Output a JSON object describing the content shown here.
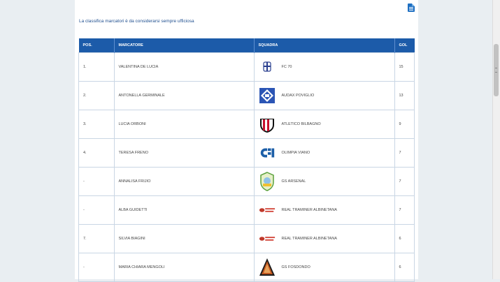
{
  "notice": "La classifica marcatori è da considerarsi sempre ufficiosa",
  "table": {
    "headers": {
      "pos": "POS.",
      "scorer": "MARCATORE",
      "team": "SQUADRA",
      "goals": "GOL"
    },
    "rows": [
      {
        "pos": "1.",
        "scorer": "VALENTINA DE LUCIA",
        "team": "FC 70",
        "goals": "15",
        "logo": "fc70-crest-icon"
      },
      {
        "pos": "2.",
        "scorer": "ANTONELLA GERMINALE",
        "team": "AUDAX POVIGLIO",
        "goals": "13",
        "logo": "audax-poviglio-crest-icon"
      },
      {
        "pos": "3.",
        "scorer": "LUCIA ORBONI",
        "team": "ATLETICO BILBAGNO",
        "goals": "9",
        "logo": "atletico-bilbagno-crest-icon"
      },
      {
        "pos": "4.",
        "scorer": "TERESA FRENO",
        "team": "OLIMPIA VIANO",
        "goals": "7",
        "logo": "olimpia-viano-logo-icon"
      },
      {
        "pos": "-",
        "scorer": "ANNALISA FRIJIO",
        "team": "GS ARSENAL",
        "goals": "7",
        "logo": "gs-arsenal-crest-icon"
      },
      {
        "pos": "-",
        "scorer": "ALBA GUIDETTI",
        "team": "REAL TRAMINER ALBINETANA",
        "goals": "7",
        "logo": "real-traminer-logo-icon"
      },
      {
        "pos": "7.",
        "scorer": "SILVIA BIAGINI",
        "team": "REAL TRAMINER ALBINETANA",
        "goals": "6",
        "logo": "real-traminer-logo-icon"
      },
      {
        "pos": "-",
        "scorer": "MARIA CHIARA MENGOLI",
        "team": "GS FOSDONDO",
        "goals": "6",
        "logo": "gs-fosdondo-crest-icon"
      }
    ]
  },
  "colors": {
    "header_bg": "#1c5ba9",
    "notice_text": "#1f4f8f",
    "border": "#c9d6e4"
  }
}
